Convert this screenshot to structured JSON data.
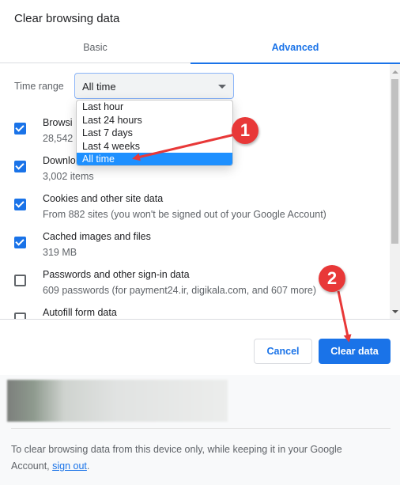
{
  "dialog": {
    "title": "Clear browsing data"
  },
  "tabs": [
    {
      "label": "Basic",
      "active": false
    },
    {
      "label": "Advanced",
      "active": true
    }
  ],
  "time_range": {
    "label": "Time range",
    "selected": "All time",
    "options": [
      "Last hour",
      "Last 24 hours",
      "Last 7 days",
      "Last 4 weeks",
      "All time"
    ]
  },
  "items": [
    {
      "label": "Browsing history",
      "visible_label": "Browsi",
      "detail": "28,542",
      "checked": true
    },
    {
      "label": "Download history",
      "visible_label": "Downlo",
      "detail": "3,002 items",
      "checked": true
    },
    {
      "label": "Cookies and other site data",
      "detail": "From 882 sites (you won't be signed out of your Google Account)",
      "checked": true
    },
    {
      "label": "Cached images and files",
      "detail": "319 MB",
      "checked": true
    },
    {
      "label": "Passwords and other sign-in data",
      "detail": "609 passwords (for payment24.ir, digikala.com, and 607 more)",
      "checked": false
    },
    {
      "label": "Autofill form data",
      "detail": "",
      "checked": false
    }
  ],
  "buttons": {
    "cancel": "Cancel",
    "clear": "Clear data"
  },
  "footer": {
    "note_prefix": "To clear browsing data from this device only, while keeping it in your Google Account, ",
    "link": "sign out",
    "note_suffix": "."
  },
  "annotations": [
    {
      "number": "1",
      "target": "All time option"
    },
    {
      "number": "2",
      "target": "Clear data button"
    }
  ],
  "colors": {
    "accent": "#1a73e8",
    "selected_option": "#1e90ff",
    "annotation": "#e83838"
  }
}
